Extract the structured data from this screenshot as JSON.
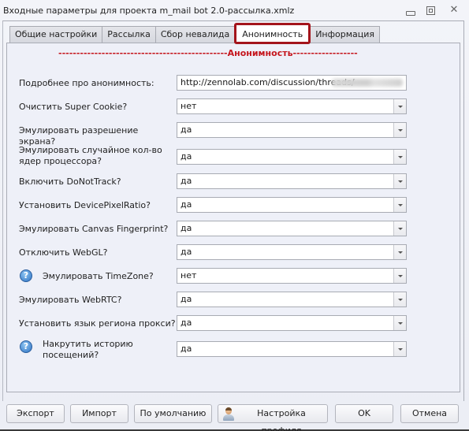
{
  "window": {
    "title": "Входные параметры для проекта m_mail bot 2.0-рассылка.xmlz",
    "controls": {
      "minimize": "minimize-icon",
      "maximize": "maximize-icon",
      "close": "close-icon"
    },
    "close_glyph": "☒"
  },
  "tabs": [
    {
      "label": "Общие настройки",
      "active": false
    },
    {
      "label": "Рассылка",
      "active": false
    },
    {
      "label": "Сбор невалида",
      "active": false
    },
    {
      "label": "Анонимность",
      "active": true
    },
    {
      "label": "Информация",
      "active": false
    }
  ],
  "panel": {
    "section_header": "-----------------------------------------------Анонимность------------------------------------------",
    "rows": [
      {
        "label": "Подробнее про анонимность:",
        "value": "http://zennolab.com/discussion/threads/",
        "type": "text",
        "help": false,
        "blurred_suffix": true
      },
      {
        "label": "Очистить Super Cookie?",
        "value": "нет",
        "type": "select",
        "help": false
      },
      {
        "label": "Эмулировать разрешение экрана?",
        "value": "да",
        "type": "select",
        "help": false
      },
      {
        "label": "Эмулировать случайное кол-во ядер процессора?",
        "value": "да",
        "type": "select",
        "help": false
      },
      {
        "label": "Включить DoNotTrack?",
        "value": "да",
        "type": "select",
        "help": false
      },
      {
        "label": "Установить DevicePixelRatio?",
        "value": "да",
        "type": "select",
        "help": false
      },
      {
        "label": "Эмулировать Canvas Fingerprint?",
        "value": "да",
        "type": "select",
        "help": false
      },
      {
        "label": "Отключить WebGL?",
        "value": "да",
        "type": "select",
        "help": false
      },
      {
        "label": "Эмулировать TimeZone?",
        "value": "нет",
        "type": "select",
        "help": true
      },
      {
        "label": "Эмулировать WebRTC?",
        "value": "да",
        "type": "select",
        "help": false
      },
      {
        "label": "Установить язык региона прокси?",
        "value": "да",
        "type": "select",
        "help": false
      },
      {
        "label": "Накрутить историю посещений?",
        "value": "да",
        "type": "select",
        "help": true
      }
    ],
    "help_glyph": "?"
  },
  "footer": {
    "export": "Экспорт",
    "import": "Импорт",
    "defaults": "По умолчанию",
    "profile_settings": "Настройка профиля",
    "ok": "OK",
    "cancel": "Отмена"
  },
  "colors": {
    "accent_red": "#c5161d",
    "active_tab_border": "#a3141b"
  }
}
